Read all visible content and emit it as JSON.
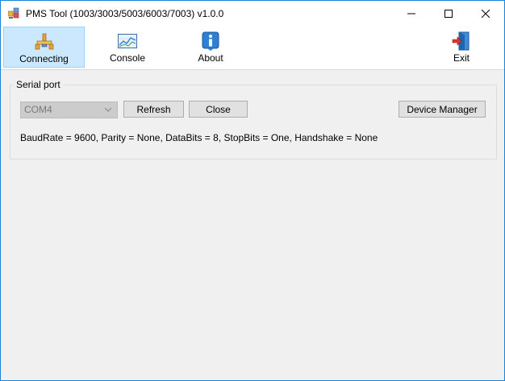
{
  "window": {
    "title": "PMS Tool (1003/3003/5003/6003/7003) v1.0.0",
    "accent_color": "#1883d7"
  },
  "titlebar": {
    "app_icon": "app-grid-icon",
    "minimize_icon": "minimize-icon",
    "maximize_icon": "maximize-icon",
    "close_icon": "close-icon"
  },
  "toolbar": {
    "items": [
      {
        "label": "Connecting",
        "icon": "network-connect-icon",
        "active": true
      },
      {
        "label": "Console",
        "icon": "chart-console-icon",
        "active": false
      },
      {
        "label": "About",
        "icon": "info-icon",
        "active": false
      },
      {
        "label": "Exit",
        "icon": "exit-door-icon",
        "active": false
      }
    ]
  },
  "serial_port": {
    "group_title": "Serial port",
    "port_value": "COM4",
    "refresh_label": "Refresh",
    "close_label": "Close",
    "device_manager_label": "Device Manager",
    "settings_text": "BaudRate = 9600, Parity = None, DataBits = 8, StopBits = One, Handshake = None"
  }
}
